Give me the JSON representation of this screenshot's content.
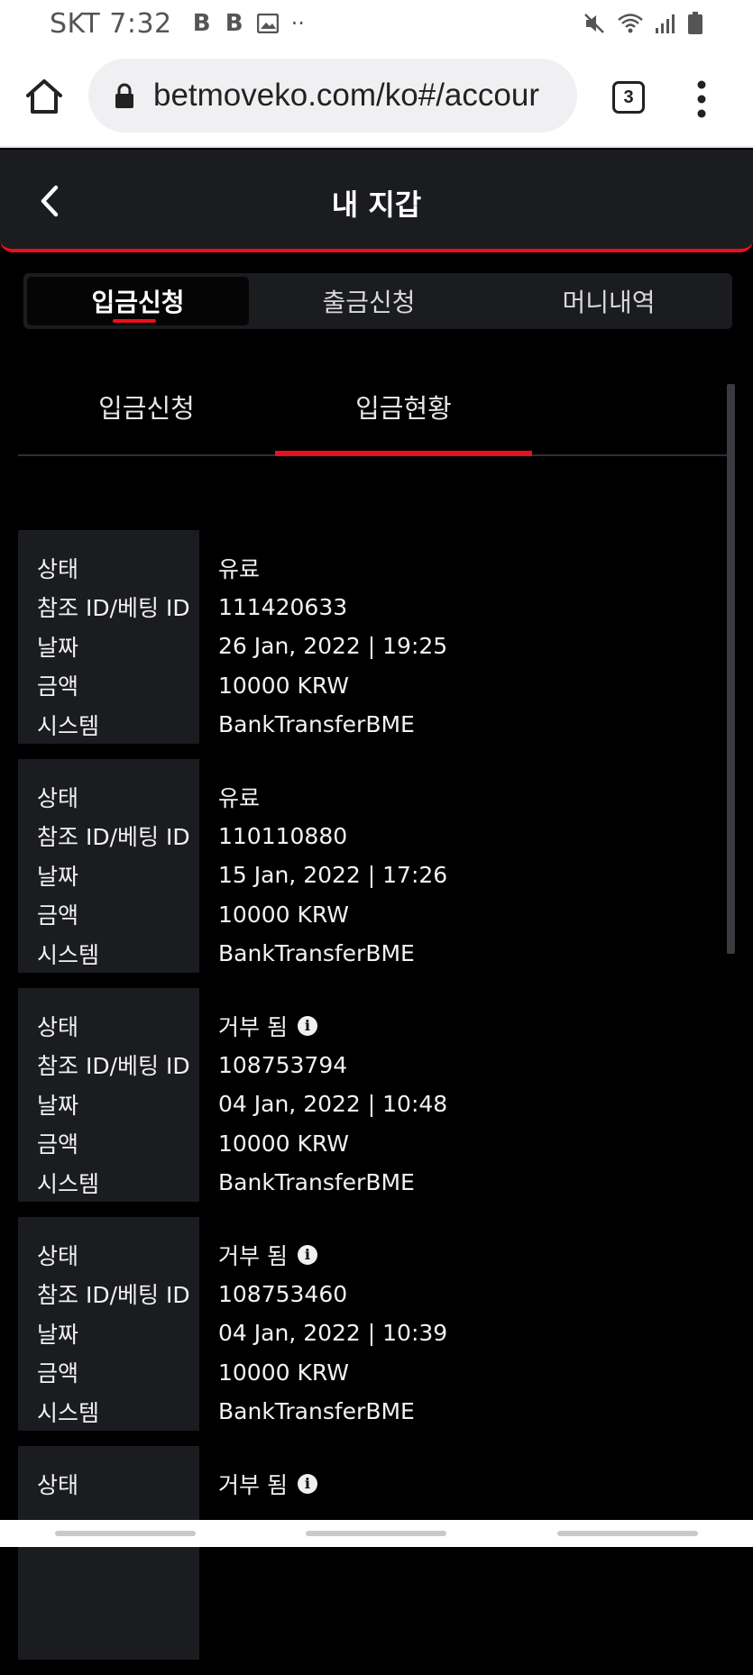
{
  "status_bar": {
    "carrier_time": "SKT 7:32",
    "notif_icons": [
      "B",
      "B"
    ],
    "more": "··"
  },
  "browser": {
    "url": "betmoveko.com/ko#/accour",
    "tab_count": "3"
  },
  "header": {
    "title": "내 지갑"
  },
  "main_tabs": [
    {
      "label": "입금신청",
      "active": true
    },
    {
      "label": "출금신청",
      "active": false
    },
    {
      "label": "머니내역",
      "active": false
    }
  ],
  "sub_tabs": [
    {
      "label": "입금신청",
      "active": false
    },
    {
      "label": "입금현황",
      "active": true
    }
  ],
  "field_labels": {
    "status": "상태",
    "ref_id": "참조 ID/베팅 ID",
    "date": "날짜",
    "amount": "금액",
    "system": "시스템"
  },
  "transactions": [
    {
      "status": "유료",
      "ref_id": "111420633",
      "date": "26 Jan, 2022 | 19:25",
      "amount": "10000 KRW",
      "system": "BankTransferBME",
      "info": false
    },
    {
      "status": "유료",
      "ref_id": "110110880",
      "date": "15 Jan, 2022 | 17:26",
      "amount": "10000 KRW",
      "system": "BankTransferBME",
      "info": false
    },
    {
      "status": "거부 됨",
      "ref_id": "108753794",
      "date": "04 Jan, 2022 | 10:48",
      "amount": "10000 KRW",
      "system": "BankTransferBME",
      "info": true
    },
    {
      "status": "거부 됨",
      "ref_id": "108753460",
      "date": "04 Jan, 2022 | 10:39",
      "amount": "10000 KRW",
      "system": "BankTransferBME",
      "info": true
    },
    {
      "status": "거부 됨",
      "info": true
    }
  ],
  "colors": {
    "accent": "#e8101c",
    "panel": "#1b1c20",
    "background": "#000000"
  }
}
